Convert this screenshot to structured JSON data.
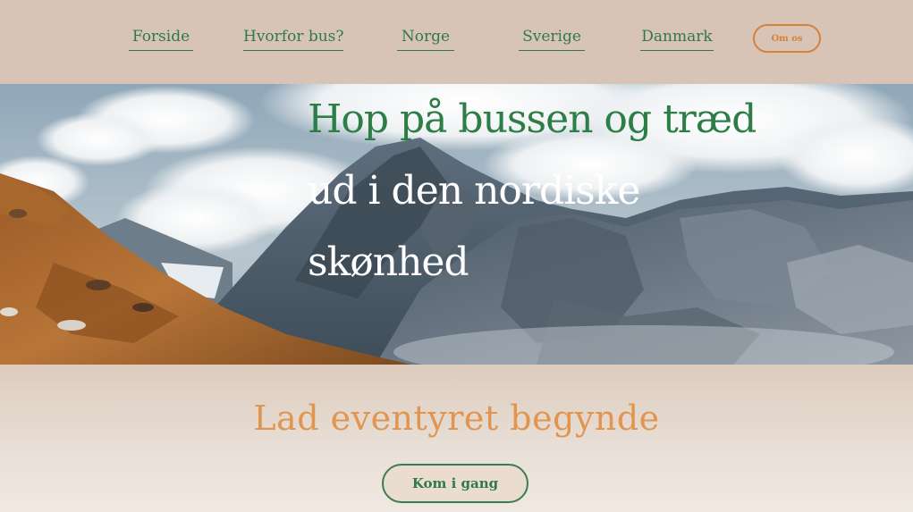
{
  "nav": {
    "items": [
      {
        "label": "Forside"
      },
      {
        "label": "Hvorfor bus?"
      },
      {
        "label": "Norge"
      },
      {
        "label": "Sverige"
      },
      {
        "label": "Danmark"
      }
    ],
    "about_button": "Om os"
  },
  "hero": {
    "title_line1": "Hop på bussen og træd",
    "title_line2": "ud i den nordiske",
    "title_line3": "skønhed"
  },
  "cta": {
    "heading": "Lad eventyret begynde",
    "button": "Kom i gang"
  },
  "colors": {
    "nav_background": "#d8c4b6",
    "nav_link": "#2f7a48",
    "accent_orange": "#d9803a",
    "heading_orange": "#e2954f",
    "title_green": "#2d7d46",
    "title_white": "#ffffff"
  },
  "icons": {
    "hero_image": "mountain-landscape-image"
  }
}
